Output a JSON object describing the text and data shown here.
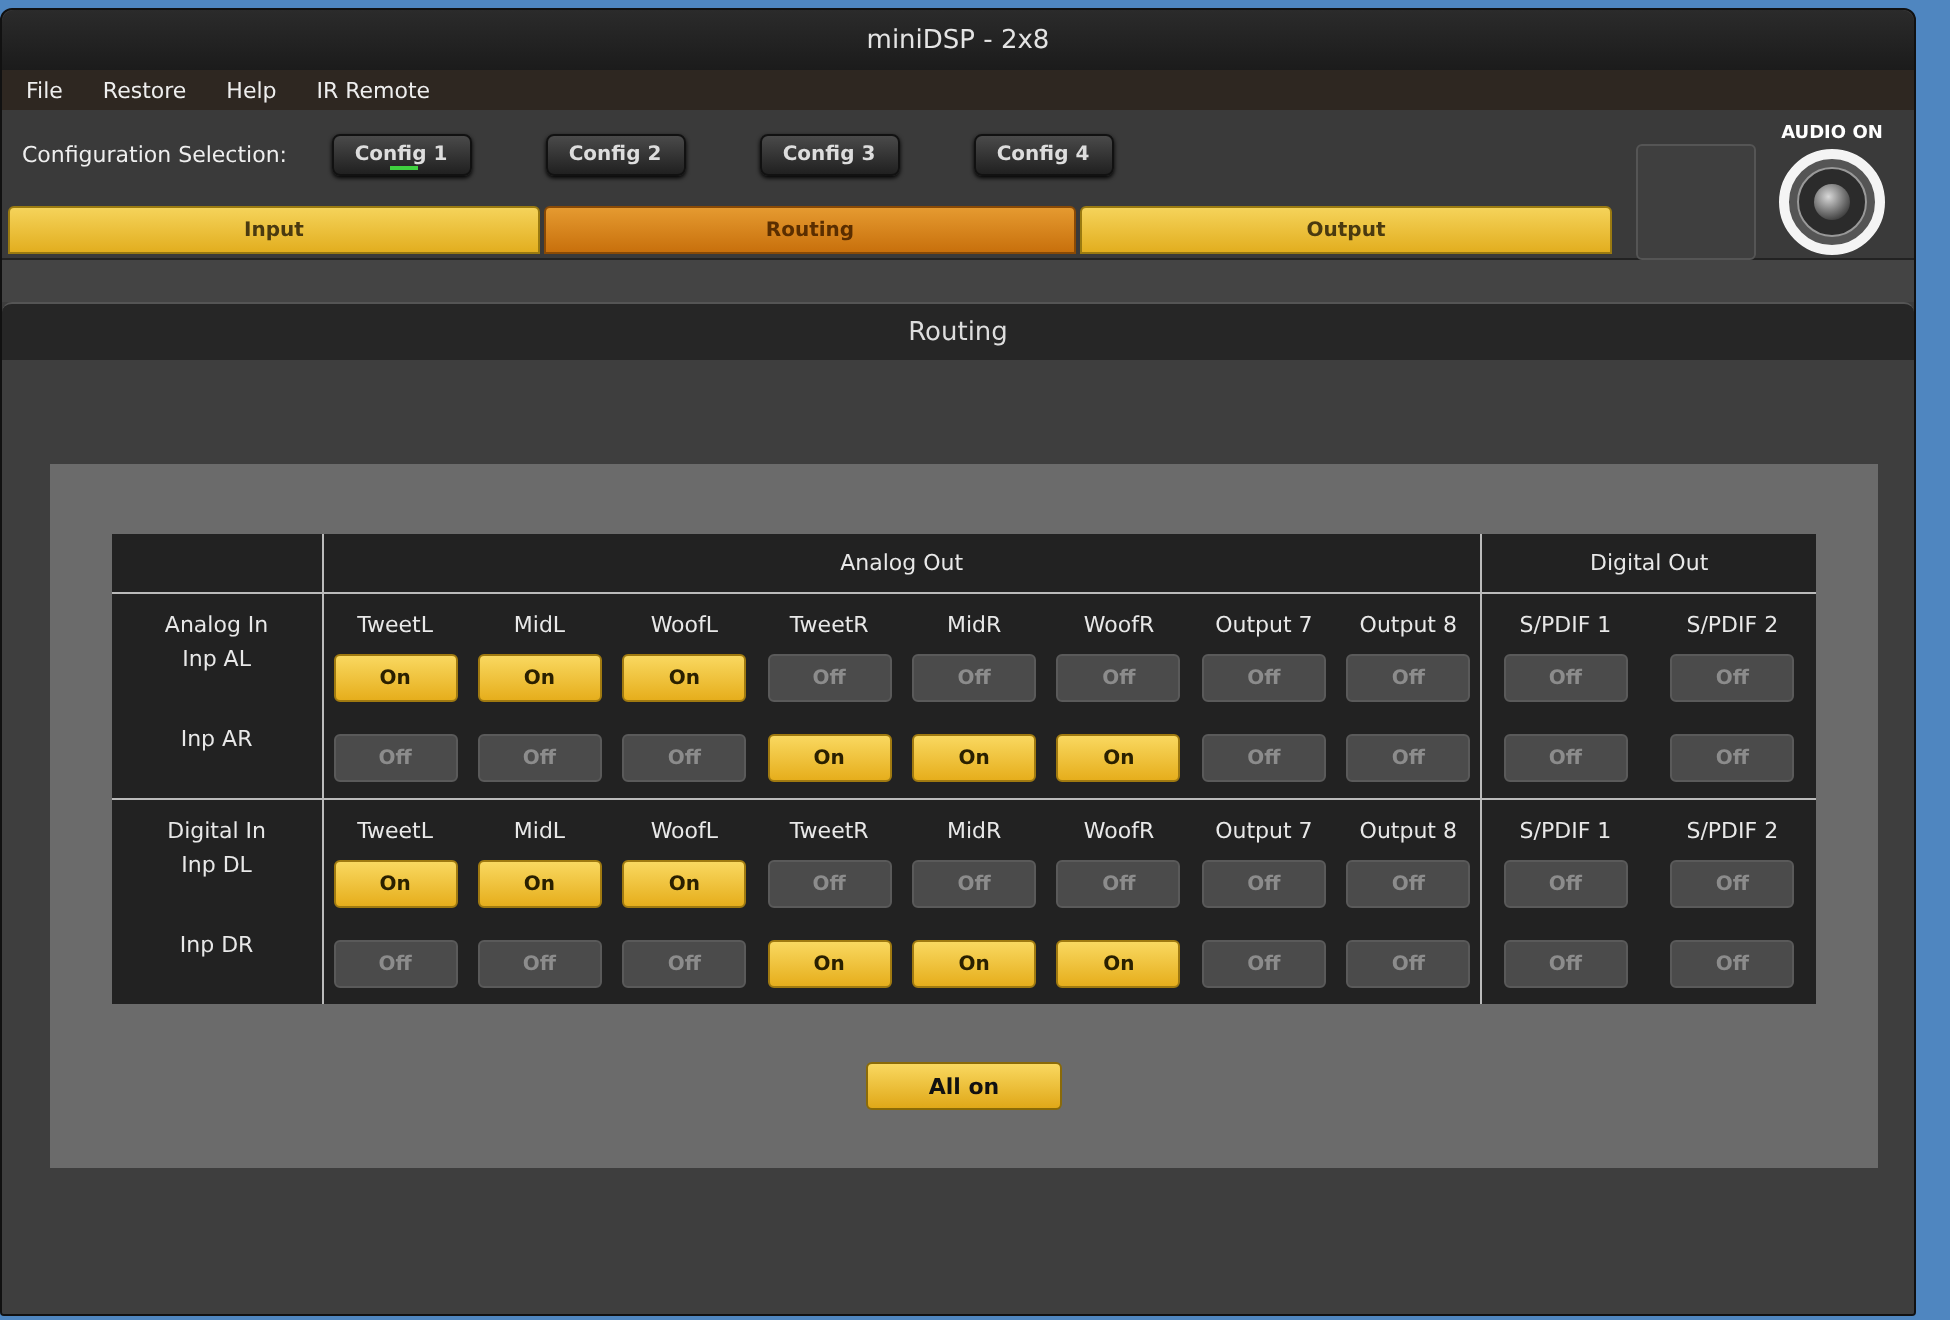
{
  "window": {
    "title": "miniDSP - 2x8"
  },
  "menu": [
    {
      "label": "File"
    },
    {
      "label": "Restore"
    },
    {
      "label": "Help"
    },
    {
      "label": "IR Remote"
    }
  ],
  "config": {
    "label": "Configuration Selection:",
    "options": [
      {
        "label": "Config 1",
        "selected": true
      },
      {
        "label": "Config 2",
        "selected": false
      },
      {
        "label": "Config 3",
        "selected": false
      },
      {
        "label": "Config 4",
        "selected": false
      }
    ]
  },
  "tabs": [
    {
      "label": "Input",
      "selected": false
    },
    {
      "label": "Routing",
      "selected": true
    },
    {
      "label": "Output",
      "selected": false
    }
  ],
  "audio": {
    "label": "AUDIO ON",
    "on": true
  },
  "panel": {
    "title": "Routing"
  },
  "routing": {
    "outputs": [
      {
        "label": "Analog Out",
        "kind": "analog"
      },
      {
        "label": "Digital Out",
        "kind": "digital"
      }
    ],
    "sections": [
      {
        "label": "Analog In",
        "columns": [
          {
            "label": "TweetL",
            "kind": "analog"
          },
          {
            "label": "MidL",
            "kind": "analog"
          },
          {
            "label": "WoofL",
            "kind": "analog"
          },
          {
            "label": "TweetR",
            "kind": "analog"
          },
          {
            "label": "MidR",
            "kind": "analog"
          },
          {
            "label": "WoofR",
            "kind": "analog"
          },
          {
            "label": "Output 7",
            "kind": "analog"
          },
          {
            "label": "Output 8",
            "kind": "analog"
          },
          {
            "label": "S/PDIF 1",
            "kind": "digital"
          },
          {
            "label": "S/PDIF 2",
            "kind": "digital"
          }
        ],
        "rows": [
          {
            "label": "Inp AL",
            "cells": [
              {
                "label": "On",
                "on": true
              },
              {
                "label": "On",
                "on": true
              },
              {
                "label": "On",
                "on": true
              },
              {
                "label": "Off",
                "on": false
              },
              {
                "label": "Off",
                "on": false
              },
              {
                "label": "Off",
                "on": false
              },
              {
                "label": "Off",
                "on": false
              },
              {
                "label": "Off",
                "on": false
              },
              {
                "label": "Off",
                "on": false
              },
              {
                "label": "Off",
                "on": false
              }
            ]
          },
          {
            "label": "Inp AR",
            "cells": [
              {
                "label": "Off",
                "on": false
              },
              {
                "label": "Off",
                "on": false
              },
              {
                "label": "Off",
                "on": false
              },
              {
                "label": "On",
                "on": true
              },
              {
                "label": "On",
                "on": true
              },
              {
                "label": "On",
                "on": true
              },
              {
                "label": "Off",
                "on": false
              },
              {
                "label": "Off",
                "on": false
              },
              {
                "label": "Off",
                "on": false
              },
              {
                "label": "Off",
                "on": false
              }
            ]
          }
        ]
      },
      {
        "label": "Digital In",
        "columns": [
          {
            "label": "TweetL",
            "kind": "analog"
          },
          {
            "label": "MidL",
            "kind": "analog"
          },
          {
            "label": "WoofL",
            "kind": "analog"
          },
          {
            "label": "TweetR",
            "kind": "analog"
          },
          {
            "label": "MidR",
            "kind": "analog"
          },
          {
            "label": "WoofR",
            "kind": "analog"
          },
          {
            "label": "Output 7",
            "kind": "analog"
          },
          {
            "label": "Output 8",
            "kind": "analog"
          },
          {
            "label": "S/PDIF 1",
            "kind": "digital"
          },
          {
            "label": "S/PDIF 2",
            "kind": "digital"
          }
        ],
        "rows": [
          {
            "label": "Inp DL",
            "cells": [
              {
                "label": "On",
                "on": true
              },
              {
                "label": "On",
                "on": true
              },
              {
                "label": "On",
                "on": true
              },
              {
                "label": "Off",
                "on": false
              },
              {
                "label": "Off",
                "on": false
              },
              {
                "label": "Off",
                "on": false
              },
              {
                "label": "Off",
                "on": false
              },
              {
                "label": "Off",
                "on": false
              },
              {
                "label": "Off",
                "on": false
              },
              {
                "label": "Off",
                "on": false
              }
            ]
          },
          {
            "label": "Inp DR",
            "cells": [
              {
                "label": "Off",
                "on": false
              },
              {
                "label": "Off",
                "on": false
              },
              {
                "label": "Off",
                "on": false
              },
              {
                "label": "On",
                "on": true
              },
              {
                "label": "On",
                "on": true
              },
              {
                "label": "On",
                "on": true
              },
              {
                "label": "Off",
                "on": false
              },
              {
                "label": "Off",
                "on": false
              },
              {
                "label": "Off",
                "on": false
              },
              {
                "label": "Off",
                "on": false
              }
            ]
          }
        ]
      }
    ]
  },
  "all_on_button": {
    "label": "All on"
  }
}
